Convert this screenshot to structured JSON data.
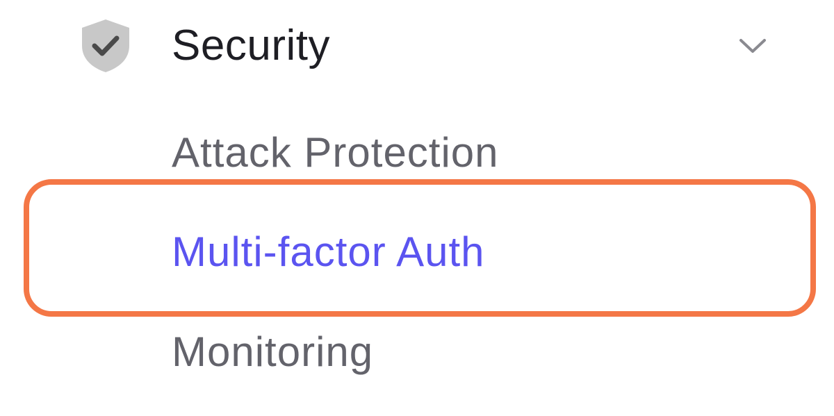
{
  "sidebar": {
    "section": {
      "title": "Security",
      "icon": "shield-check-icon",
      "expand_icon": "chevron-down-icon",
      "expanded": true
    },
    "items": [
      {
        "label": "Attack Protection",
        "active": false
      },
      {
        "label": "Multi-factor Auth",
        "active": true
      },
      {
        "label": "Monitoring",
        "active": false
      }
    ]
  },
  "colors": {
    "title_text": "#1e1e24",
    "item_text": "#63636b",
    "active_text": "#5b54f0",
    "highlight_outline": "#f47746",
    "shield_fill": "#c8c8c8",
    "check_mark": "#4a4a4a",
    "chevron": "#8a8a90"
  }
}
